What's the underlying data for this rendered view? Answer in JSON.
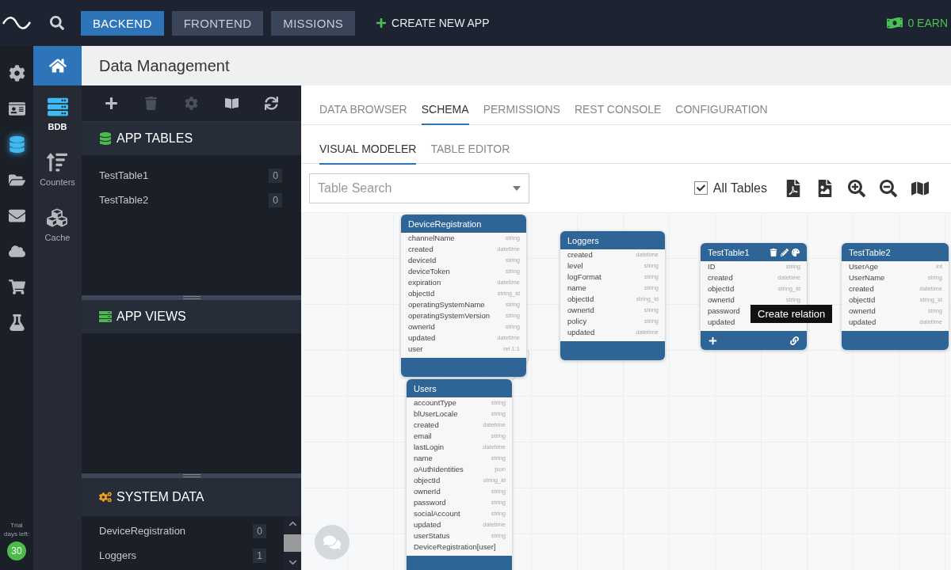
{
  "topbar": {
    "nav": [
      {
        "label": "BACKEND",
        "selected": true
      },
      {
        "label": "FRONTEND",
        "selected": false
      },
      {
        "label": "MISSIONS",
        "selected": false
      }
    ],
    "create_app": "CREATE NEW APP",
    "earn": "0 EARN"
  },
  "rail": [
    {
      "kind": "settings",
      "selected": false
    },
    {
      "kind": "contacts",
      "selected": false
    },
    {
      "kind": "database",
      "selected": true
    },
    {
      "kind": "folder",
      "selected": false
    },
    {
      "kind": "mail",
      "selected": false
    },
    {
      "kind": "cloud",
      "selected": false
    },
    {
      "kind": "cart",
      "selected": false
    },
    {
      "kind": "lab",
      "selected": false
    }
  ],
  "trial": {
    "label": "Trial days left:",
    "days": "30"
  },
  "subrail": [
    {
      "kind": "bdb",
      "label": "BDB",
      "selected": true
    },
    {
      "kind": "counters",
      "label": "Counters",
      "selected": false
    },
    {
      "kind": "cache",
      "label": "Cache",
      "selected": false
    }
  ],
  "page_title": "Data Management",
  "panel_toolbar": [
    {
      "kind": "add",
      "disabled": false
    },
    {
      "kind": "delete",
      "disabled": true
    },
    {
      "kind": "settings",
      "disabled": true
    },
    {
      "kind": "docs",
      "disabled": false
    },
    {
      "kind": "refresh",
      "disabled": false
    }
  ],
  "app_tables": {
    "title": "APP TABLES",
    "items": [
      {
        "name": "TestTable1",
        "count": "0"
      },
      {
        "name": "TestTable2",
        "count": "0"
      }
    ]
  },
  "app_views": {
    "title": "APP VIEWS"
  },
  "system_data": {
    "title": "SYSTEM DATA",
    "items": [
      {
        "name": "DeviceRegistration",
        "count": "0"
      },
      {
        "name": "Loggers",
        "count": "1"
      }
    ]
  },
  "tabs": [
    {
      "label": "DATA BROWSER",
      "selected": false
    },
    {
      "label": "SCHEMA",
      "selected": true
    },
    {
      "label": "PERMISSIONS",
      "selected": false
    },
    {
      "label": "REST CONSOLE",
      "selected": false
    },
    {
      "label": "CONFIGURATION",
      "selected": false
    }
  ],
  "subtabs": [
    {
      "label": "VISUAL MODELER",
      "selected": true
    },
    {
      "label": "TABLE EDITOR",
      "selected": false
    }
  ],
  "search": {
    "placeholder": "Table Search"
  },
  "all_tables": {
    "label": "All Tables",
    "checked": true
  },
  "tools": [
    {
      "kind": "pdf"
    },
    {
      "kind": "image"
    },
    {
      "kind": "zoom-in"
    },
    {
      "kind": "zoom-out"
    },
    {
      "kind": "map"
    }
  ],
  "tables": [
    {
      "name": "DeviceRegistration",
      "actions": false,
      "fields": [
        {
          "name": "channelName",
          "type": "string"
        },
        {
          "name": "created",
          "type": "datetime"
        },
        {
          "name": "deviceId",
          "type": "string"
        },
        {
          "name": "deviceToken",
          "type": "string"
        },
        {
          "name": "expiration",
          "type": "datetime"
        },
        {
          "name": "objectId",
          "type": "string_id"
        },
        {
          "name": "operatingSystemName",
          "type": "string"
        },
        {
          "name": "operatingSystemVersion",
          "type": "string"
        },
        {
          "name": "ownerId",
          "type": "string"
        },
        {
          "name": "updated",
          "type": "datetime"
        },
        {
          "name": "user",
          "type": "rel 1:1"
        }
      ]
    },
    {
      "name": "Loggers",
      "actions": false,
      "fields": [
        {
          "name": "created",
          "type": "datetime"
        },
        {
          "name": "level",
          "type": "string"
        },
        {
          "name": "logFormat",
          "type": "string"
        },
        {
          "name": "name",
          "type": "string"
        },
        {
          "name": "objectId",
          "type": "string_id"
        },
        {
          "name": "ownerId",
          "type": "string"
        },
        {
          "name": "policy",
          "type": "string"
        },
        {
          "name": "updated",
          "type": "datetime"
        }
      ]
    },
    {
      "name": "TestTable1",
      "actions": true,
      "fields": [
        {
          "name": "ID",
          "type": "string"
        },
        {
          "name": "created",
          "type": "datetime"
        },
        {
          "name": "objectId",
          "type": "string_id"
        },
        {
          "name": "ownerId",
          "type": "string"
        },
        {
          "name": "password"
        },
        {
          "name": "updated"
        }
      ]
    },
    {
      "name": "TestTable2",
      "actions": false,
      "fields": [
        {
          "name": "UserAge",
          "type": "int"
        },
        {
          "name": "UserName",
          "type": "string"
        },
        {
          "name": "created",
          "type": "datetime"
        },
        {
          "name": "objectId",
          "type": "string_id"
        },
        {
          "name": "ownerId",
          "type": "string"
        },
        {
          "name": "updated",
          "type": "datetime"
        }
      ]
    },
    {
      "name": "Users",
      "actions": false,
      "fields": [
        {
          "name": "accountType",
          "type": "string"
        },
        {
          "name": "blUserLocale",
          "type": "string"
        },
        {
          "name": "created",
          "type": "datetime"
        },
        {
          "name": "email",
          "type": "string"
        },
        {
          "name": "lastLogin",
          "type": "datetime"
        },
        {
          "name": "name",
          "type": "string"
        },
        {
          "name": "oAuthIdentities",
          "type": "json"
        },
        {
          "name": "objectId",
          "type": "string_id"
        },
        {
          "name": "ownerId",
          "type": "string"
        },
        {
          "name": "password",
          "type": "string"
        },
        {
          "name": "socialAccount",
          "type": "string"
        },
        {
          "name": "updated",
          "type": "datetime"
        },
        {
          "name": "userStatus",
          "type": "string"
        },
        {
          "name": "DeviceRegistration[user]"
        }
      ]
    }
  ],
  "tooltip": "Create relation"
}
